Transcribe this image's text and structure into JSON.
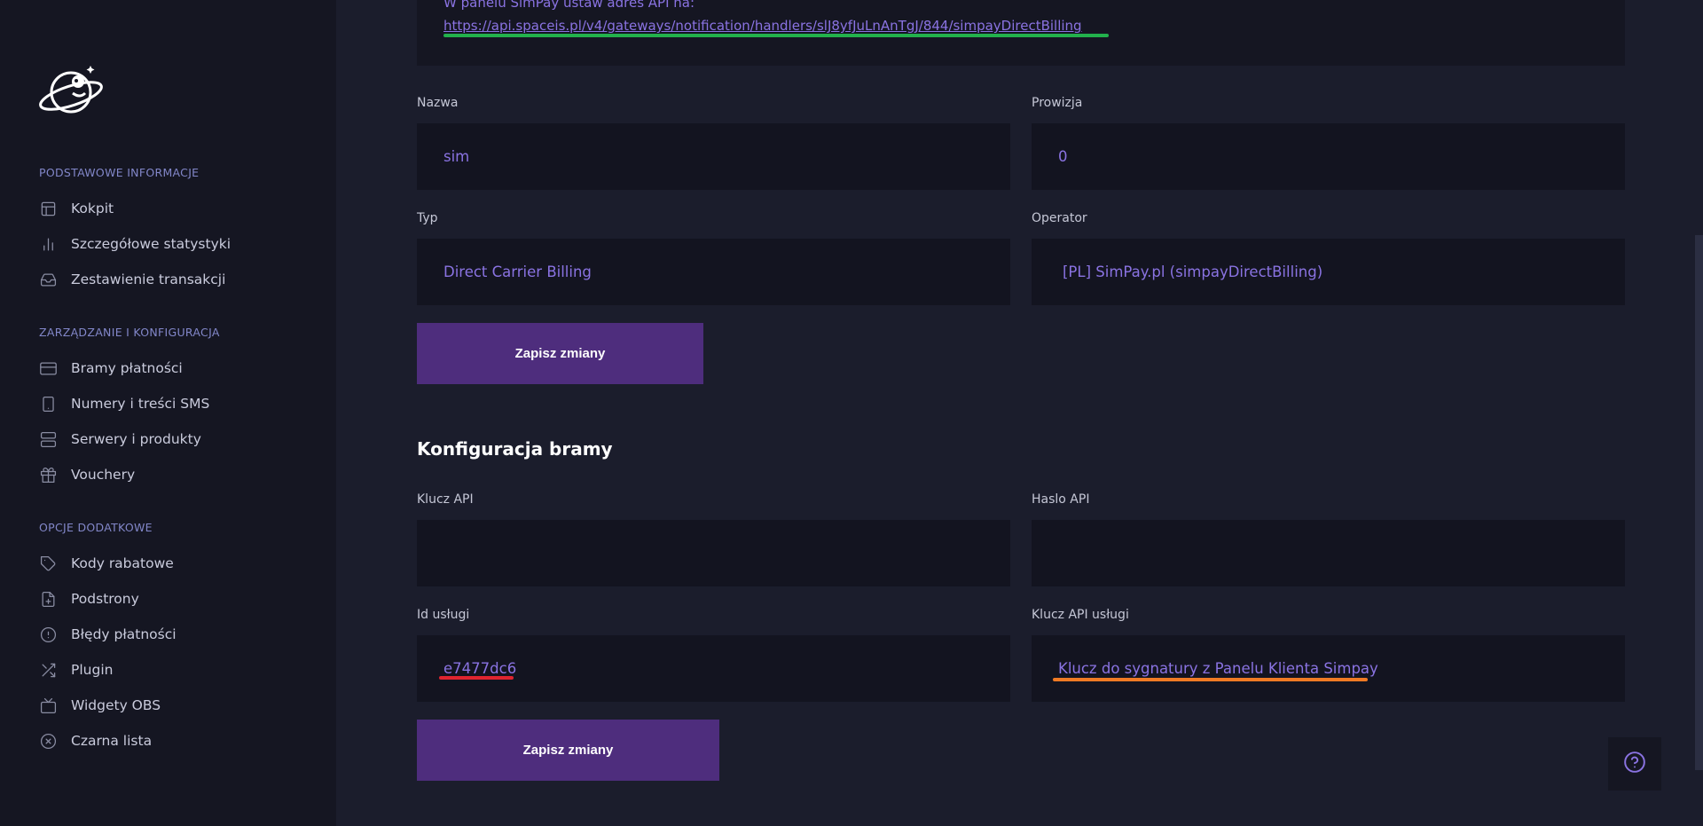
{
  "sidebar": {
    "logo_icon": "planet-astronaut-logo",
    "sections": [
      {
        "title": "PODSTAWOWE INFORMACJE",
        "items": [
          {
            "label": "Kokpit",
            "icon": "layout-icon"
          },
          {
            "label": "Szczegółowe statystyki",
            "icon": "bar-chart-icon"
          },
          {
            "label": "Zestawienie transakcji",
            "icon": "inbox-icon"
          }
        ]
      },
      {
        "title": "ZARZĄDZANIE I KONFIGURACJA",
        "items": [
          {
            "label": "Bramy płatności",
            "icon": "credit-card-icon"
          },
          {
            "label": "Numery i treści SMS",
            "icon": "smartphone-icon"
          },
          {
            "label": "Serwery i produkty",
            "icon": "server-icon"
          },
          {
            "label": "Vouchery",
            "icon": "gift-icon"
          }
        ]
      },
      {
        "title": "OPCJE DODATKOWE",
        "items": [
          {
            "label": "Kody rabatowe",
            "icon": "tag-icon"
          },
          {
            "label": "Podstrony",
            "icon": "file-plus-icon"
          },
          {
            "label": "Błędy płatności",
            "icon": "alert-circle-icon"
          },
          {
            "label": "Plugin",
            "icon": "shuffle-icon"
          },
          {
            "label": "Widgety OBS",
            "icon": "tv-icon"
          },
          {
            "label": "Czarna lista",
            "icon": "x-circle-icon"
          }
        ]
      }
    ]
  },
  "top_info": {
    "text": "W panelu SimPay ustaw adres API na:",
    "url": "https://api.spaceis.pl/v4/gateways/notification/handlers/slJ8yfJuLnAnTgJ/844/simpayDirectBilling"
  },
  "gateway_form": {
    "name_label": "Nazwa",
    "name_value": "sim",
    "commission_label": "Prowizja",
    "commission_value": "0",
    "type_label": "Typ",
    "type_value": "Direct Carrier Billing",
    "operator_label": "Operator",
    "operator_value": "[PL] SimPay.pl (simpayDirectBilling)",
    "save_label": "Zapisz zmiany"
  },
  "gateway_config": {
    "heading": "Konfiguracja bramy",
    "api_key_label": "Klucz API",
    "api_key_value": "",
    "api_password_label": "Haslo API",
    "api_password_value": "",
    "service_id_label": "Id usługi",
    "service_id_value": "e7477dc6",
    "service_api_key_label": "Klucz API usługi",
    "service_api_key_value": "Klucz do sygnatury z Panelu Klienta Simpay",
    "save_label": "Zapisz zmiany"
  },
  "colors": {
    "accent": "#8a73e2",
    "button": "#4e2d7d",
    "annotation_green": "#22b14c",
    "annotation_red": "#e0242f",
    "annotation_orange": "#f07a24"
  },
  "help_icon": "question-circle-icon"
}
